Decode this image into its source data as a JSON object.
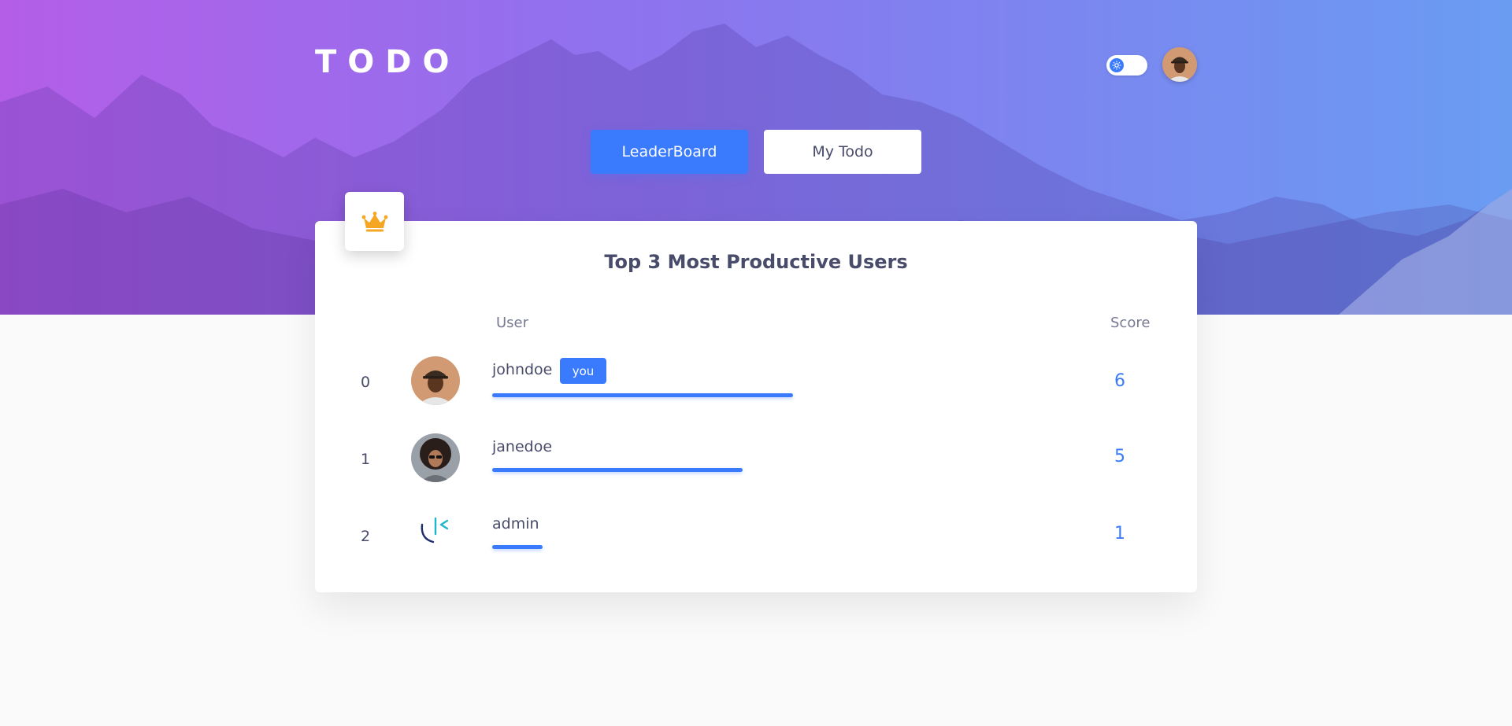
{
  "header": {
    "logo": "TODO",
    "theme_toggle": {
      "state": "light",
      "icon": "sun-icon"
    },
    "avatar_icon": "user-avatar"
  },
  "tabs": [
    {
      "label": "LeaderBoard",
      "active": true
    },
    {
      "label": "My Todo",
      "active": false
    }
  ],
  "leaderboard": {
    "badge_icon": "crown-icon",
    "title": "Top 3 Most Productive Users",
    "columns": {
      "user": "User",
      "score": "Score"
    },
    "you_label": "you",
    "rows": [
      {
        "rank": "0",
        "username": "johndoe",
        "is_you": true,
        "score": "6",
        "progress": 1.0,
        "avatar_icon": "johndoe-avatar"
      },
      {
        "rank": "1",
        "username": "janedoe",
        "is_you": false,
        "score": "5",
        "progress": 0.833,
        "avatar_icon": "janedoe-avatar"
      },
      {
        "rank": "2",
        "username": "admin",
        "is_you": false,
        "score": "1",
        "progress": 0.167,
        "avatar_icon": "admin-logo-avatar"
      }
    ]
  },
  "colors": {
    "accent": "#3a7bfd",
    "hero_gradient_start": "#b45ee8",
    "hero_gradient_end": "#6a9cf2",
    "text": "#484b6a",
    "crown": "#f5a623"
  }
}
